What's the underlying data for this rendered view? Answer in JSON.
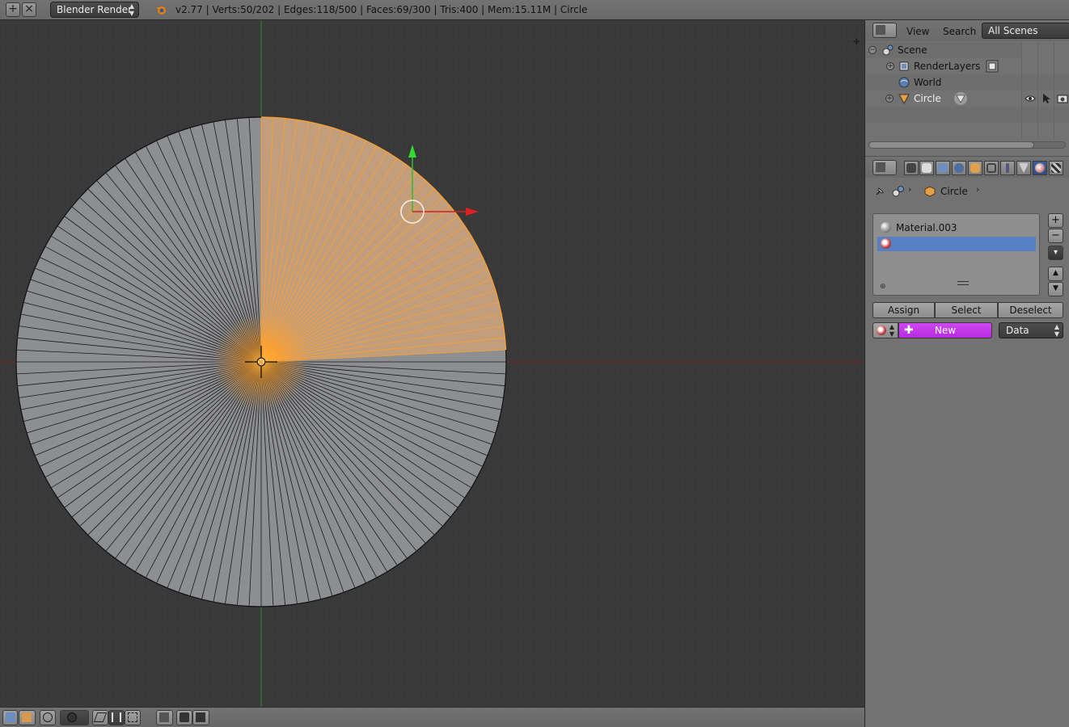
{
  "topbar": {
    "render_engine": "Blender Render",
    "stats": "v2.77 | Verts:50/202 | Edges:118/500 | Faces:69/300 | Tris:400 | Mem:15.11M | Circle"
  },
  "outliner": {
    "menu": [
      "View",
      "Search"
    ],
    "scene_filter": "All Scenes",
    "tree": [
      {
        "label": "Scene",
        "icon": "scene-icon"
      },
      {
        "label": "RenderLayers",
        "icon": "render-layers-icon"
      },
      {
        "label": "World",
        "icon": "world-icon"
      },
      {
        "label": "Circle",
        "icon": "mesh-object-icon",
        "selected": true
      }
    ]
  },
  "properties": {
    "active_tab": "material",
    "breadcrumb_object": "Circle",
    "material_slots": [
      {
        "label": "Material.003",
        "selected": false
      },
      {
        "label": "",
        "selected": true
      }
    ],
    "assign_label": "Assign",
    "select_label": "Select",
    "deselect_label": "Deselect",
    "new_label": "New",
    "link_select": "Data"
  },
  "colors": {
    "viewport_bg": "#393939",
    "mesh_face": "#8d8e91",
    "selection": "#ffa02b",
    "axis_x": "#c32323",
    "axis_y": "#2ea82e",
    "new_button": "#c53cec",
    "selected_slot": "#5680c2"
  },
  "mesh": {
    "segments": 128,
    "selected_segments": 31
  }
}
